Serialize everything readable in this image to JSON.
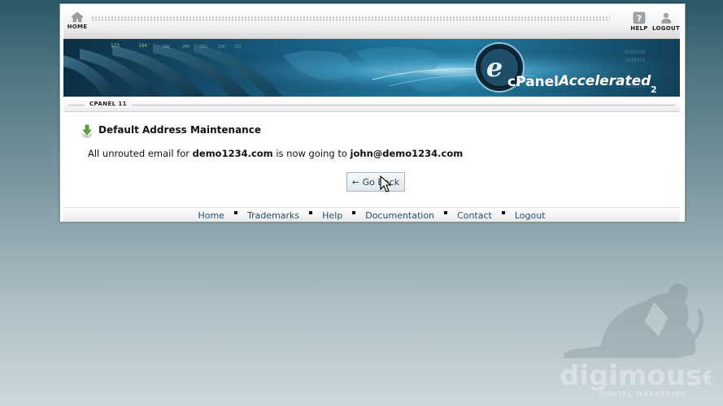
{
  "topbar": {
    "home_label": "HOME",
    "help_label": "HELP",
    "logout_label": "LOGOUT"
  },
  "banner": {
    "brand_main": "cPanel",
    "brand_accent": "Accelerated",
    "brand_version": "2",
    "ticker": [
      "173",
      "184",
      "192",
      "204",
      "211",
      "226",
      "231"
    ]
  },
  "breadcrumb": "CPANEL 11",
  "page": {
    "title": "Default Address Maintenance",
    "message_prefix": "All unrouted email for",
    "domain": "demo1234.com",
    "message_mid": "is now going to",
    "target": "john@demo1234.com",
    "go_back_label": "← Go Back"
  },
  "footer": {
    "links": [
      "Home",
      "Trademarks",
      "Help",
      "Documentation",
      "Contact",
      "Logout"
    ]
  },
  "watermark": {
    "brand": "digimouse",
    "tagline": "DIGITAL MARKETING"
  },
  "colors": {
    "link": "#1f4f74",
    "banner_dark": "#0d2e42",
    "banner_light": "#1f7aa0"
  },
  "icons": [
    "home-icon",
    "help-icon",
    "logout-icon",
    "download-arrow-icon",
    "mouse-cursor-icon"
  ]
}
